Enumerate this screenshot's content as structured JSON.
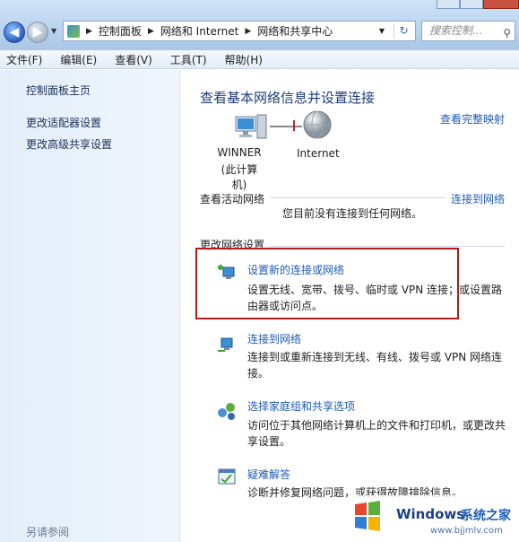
{
  "address": {
    "crumbs": [
      "控制面板",
      "网络和 Internet",
      "网络和共享中心"
    ]
  },
  "search": {
    "placeholder": "搜索控制..."
  },
  "menu": [
    "文件(F)",
    "编辑(E)",
    "查看(V)",
    "工具(T)",
    "帮助(H)"
  ],
  "left": {
    "home": "控制面板主页",
    "adapter": "更改适配器设置",
    "advanced": "更改高级共享设置",
    "see_also": "另请参阅"
  },
  "main": {
    "heading": "查看基本网络信息并设置连接",
    "view_map": "查看完整映射",
    "pc_name": "WINNER",
    "pc_sub": "(此计算机)",
    "internet": "Internet",
    "active_title": "查看活动网络",
    "connect_link": "连接到网络",
    "no_conn": "您目前没有连接到任何网络。",
    "change_title": "更改网络设置",
    "tasks": [
      {
        "title": "设置新的连接或网络",
        "desc": "设置无线、宽带、拨号、临时或 VPN 连接；或设置路由器或访问点。"
      },
      {
        "title": "连接到网络",
        "desc": "连接到或重新连接到无线、有线、拨号或 VPN 网络连接。"
      },
      {
        "title": "选择家庭组和共享选项",
        "desc": "访问位于其他网络计算机上的文件和打印机，或更改共享设置。"
      },
      {
        "title": "疑难解答",
        "desc": "诊断并修复网络问题，或获得故障排除信息。"
      }
    ]
  },
  "watermark": {
    "brand": "Windows",
    "cn": "系统之家",
    "url": "www.bjjmlv.com"
  },
  "colors": {
    "link": "#1e5bb8",
    "heading": "#1e3d7a",
    "highlight": "#b31b1b"
  }
}
